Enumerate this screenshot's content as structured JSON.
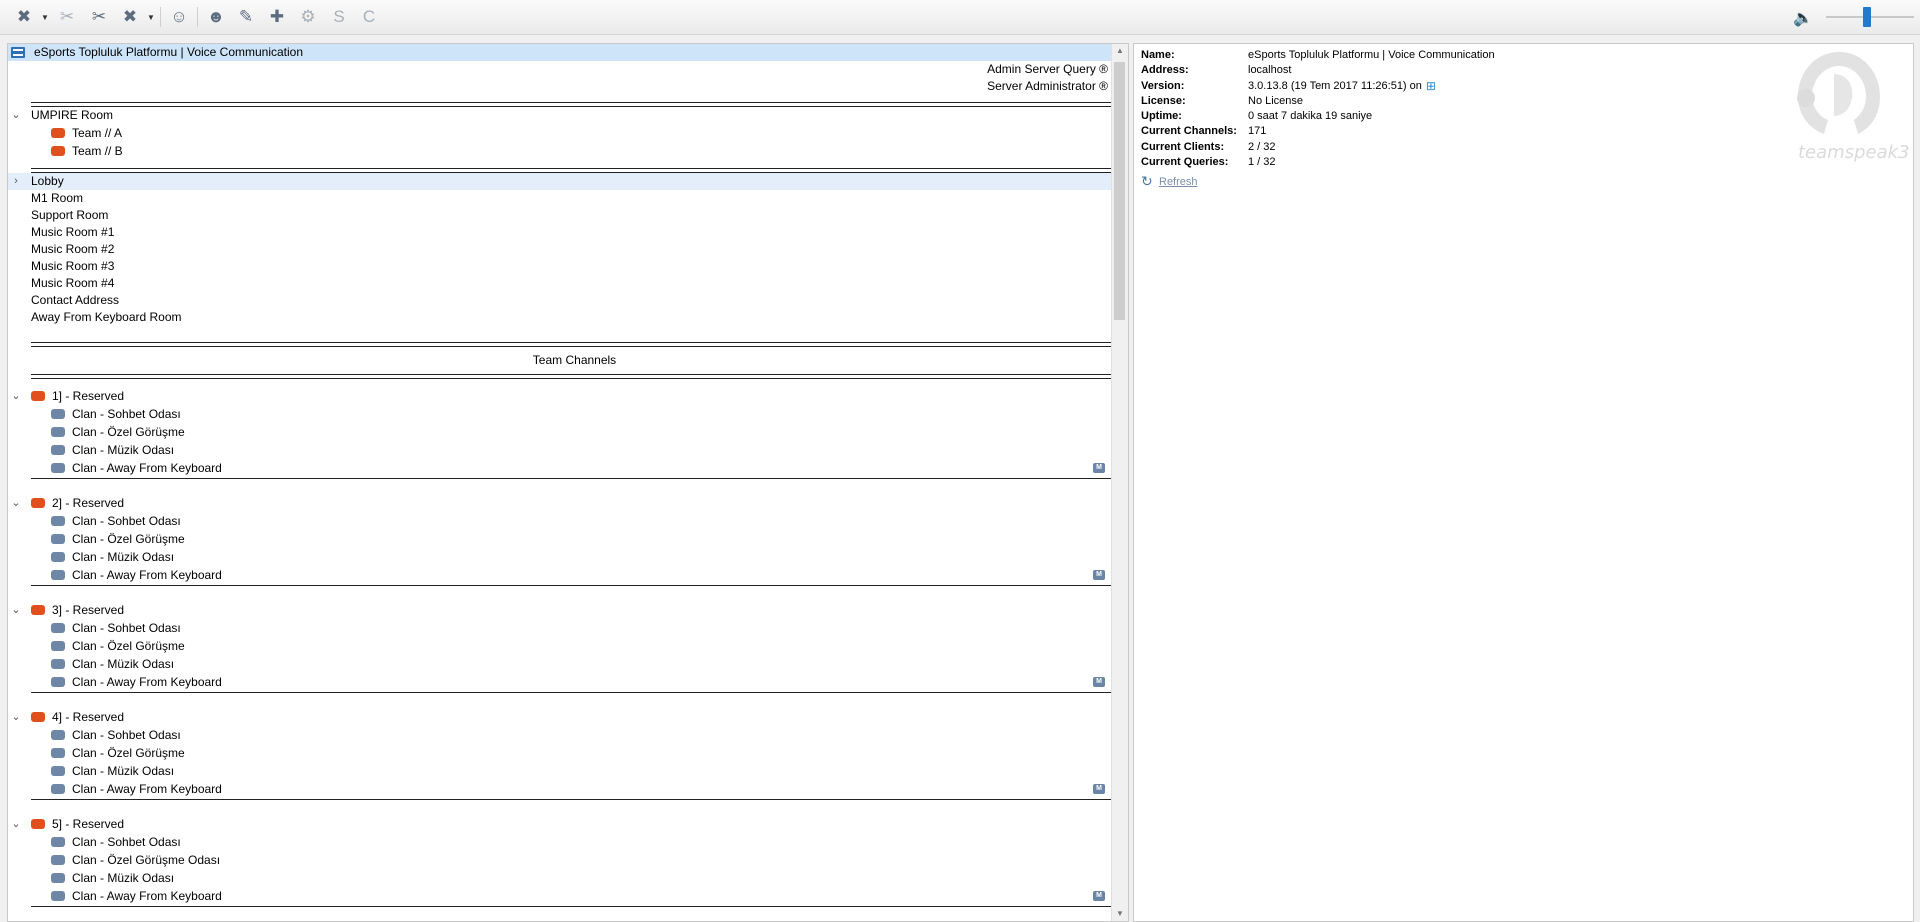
{
  "toolbar": {
    "buttons": [
      {
        "name": "connect-icon",
        "glyph": "✖",
        "disabled": false
      },
      {
        "name": "disconnect-icon",
        "glyph": "✂",
        "disabled": true
      },
      {
        "name": "disconnect-all-icon",
        "glyph": "✂",
        "disabled": false
      },
      {
        "name": "mute-microphone-icon",
        "glyph": "✖",
        "disabled": false
      },
      {
        "name": "away-icon",
        "glyph": "☺",
        "disabled": false
      },
      {
        "name": "contacts-icon",
        "glyph": "☻",
        "disabled": false
      },
      {
        "name": "whisper-icon",
        "glyph": "✎",
        "disabled": false
      },
      {
        "name": "add-bookmark-icon",
        "glyph": "✚",
        "disabled": false
      },
      {
        "name": "settings-gear-icon",
        "glyph": "⚙",
        "disabled": true
      },
      {
        "name": "server-group-icon",
        "glyph": "S",
        "disabled": true
      },
      {
        "name": "channel-group-icon",
        "glyph": "C",
        "disabled": true
      }
    ]
  },
  "server": {
    "title": "eSports Topluluk Platformu | Voice Communication",
    "admin_server_query": "Admin Server Query",
    "server_administrator": "Server Administrator",
    "registered_mark": "®"
  },
  "tree": {
    "umpire_room": "UMPIRE Room",
    "team_a": "Team // A",
    "team_b": "Team // B",
    "rooms": [
      "Lobby",
      "M1 Room",
      "Support Room",
      "Music Room #1",
      "Music Room #2",
      "Music Room #3",
      "Music Room #4",
      "Contact Address",
      "Away From Keyboard Room"
    ],
    "team_channels": "Team Channels",
    "clans": [
      {
        "title": "1] - Reserved",
        "subs": [
          "Clan - Sohbet Odası",
          "Clan - Özel Görüşme",
          "Clan - Müzik Odası",
          "Clan - Away From Keyboard"
        ]
      },
      {
        "title": "2] - Reserved",
        "subs": [
          "Clan - Sohbet Odası",
          "Clan - Özel Görüşme",
          "Clan - Müzik Odası",
          "Clan - Away From Keyboard"
        ]
      },
      {
        "title": "3] - Reserved",
        "subs": [
          "Clan - Sohbet Odası",
          "Clan - Özel Görüşme",
          "Clan - Müzik Odası",
          "Clan - Away From Keyboard"
        ]
      },
      {
        "title": "4] - Reserved",
        "subs": [
          "Clan - Sohbet Odası",
          "Clan - Özel Görüşme",
          "Clan - Müzik Odası",
          "Clan - Away From Keyboard"
        ]
      },
      {
        "title": "5] - Reserved",
        "subs": [
          "Clan - Sohbet Odası",
          "Clan - Özel Görüşme Odası",
          "Clan - Müzik Odası",
          "Clan - Away From Keyboard"
        ]
      }
    ],
    "moderated_badge": "M"
  },
  "info": {
    "name_label": "Name:",
    "name": "eSports Topluluk Platformu | Voice Communication",
    "address_label": "Address:",
    "address": "localhost",
    "version_label": "Version:",
    "version": "3.0.13.8 (19 Tem 2017 11:26:51) on",
    "license_label": "License:",
    "license": "No License",
    "uptime_label": "Uptime:",
    "uptime": "0 saat 7 dakika 19 saniye",
    "channels_label": "Current Channels:",
    "channels": "171",
    "clients_label": "Current Clients:",
    "clients": "2 / 32",
    "queries_label": "Current Queries:",
    "queries": "1 / 32",
    "refresh": "Refresh",
    "logo_text": "teamspeak3"
  },
  "colors": {
    "accent": "#1f7bd0",
    "channel_red": "#e0501e",
    "channel_blue": "#6e87a6"
  }
}
